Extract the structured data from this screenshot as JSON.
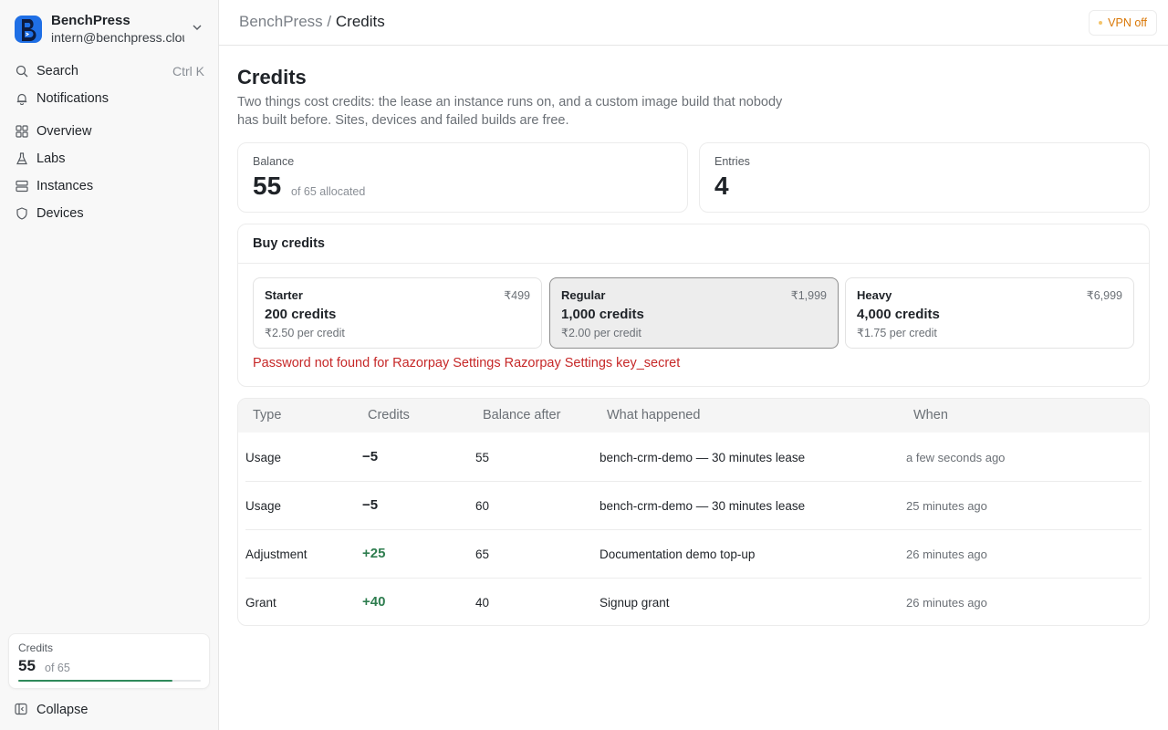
{
  "sidebar": {
    "brand_name": "BenchPress",
    "brand_email": "intern@benchpress.cloud",
    "search": {
      "label": "Search",
      "shortcut": "Ctrl K"
    },
    "items": [
      {
        "label": "Notifications",
        "icon": "bell-icon"
      },
      {
        "label": "Overview",
        "icon": "grid-icon"
      },
      {
        "label": "Labs",
        "icon": "flask-icon"
      },
      {
        "label": "Instances",
        "icon": "server-icon"
      },
      {
        "label": "Devices",
        "icon": "shield-icon"
      }
    ],
    "credits": {
      "label": "Credits",
      "value": "55",
      "of": "of 65",
      "fraction": 0.846
    },
    "collapse_label": "Collapse"
  },
  "topbar": {
    "breadcrumb_root": "BenchPress",
    "breadcrumb_sep": "/",
    "breadcrumb_current": "Credits",
    "vpn_label": "VPN off"
  },
  "page": {
    "title": "Credits",
    "description": "Two things cost credits: the lease an instance runs on, and a custom image build that nobody has built before. Sites, devices and failed builds are free."
  },
  "stats": {
    "balance": {
      "label": "Balance",
      "value": "55",
      "sub": "of 65 allocated"
    },
    "entries": {
      "label": "Entries",
      "value": "4"
    }
  },
  "buy": {
    "heading": "Buy credits",
    "plans": [
      {
        "name": "Starter",
        "price": "₹499",
        "credits": "200 credits",
        "per": "₹2.50 per credit",
        "selected": false
      },
      {
        "name": "Regular",
        "price": "₹1,999",
        "credits": "1,000 credits",
        "per": "₹2.00 per credit",
        "selected": true
      },
      {
        "name": "Heavy",
        "price": "₹6,999",
        "credits": "4,000 credits",
        "per": "₹1.75 per credit",
        "selected": false
      }
    ],
    "error": "Password not found for Razorpay Settings Razorpay Settings key_secret"
  },
  "ledger": {
    "columns": [
      "Type",
      "Credits",
      "Balance after",
      "What happened",
      "When"
    ],
    "rows": [
      {
        "type": "Usage",
        "credits": "−5",
        "balance": "55",
        "what": "bench-crm-demo — 30 minutes lease",
        "when": "a few seconds ago"
      },
      {
        "type": "Usage",
        "credits": "−5",
        "balance": "60",
        "what": "bench-crm-demo — 30 minutes lease",
        "when": "25 minutes ago"
      },
      {
        "type": "Adjustment",
        "credits": "+25",
        "balance": "65",
        "what": "Documentation demo top-up",
        "when": "26 minutes ago"
      },
      {
        "type": "Grant",
        "credits": "+40",
        "balance": "40",
        "what": "Signup grant",
        "when": "26 minutes ago"
      }
    ]
  },
  "colors": {
    "accent_green": "#2e7d4f",
    "error_red": "#c62828",
    "vpn_orange": "#d97706",
    "logo_blue": "#1f6fe5"
  }
}
